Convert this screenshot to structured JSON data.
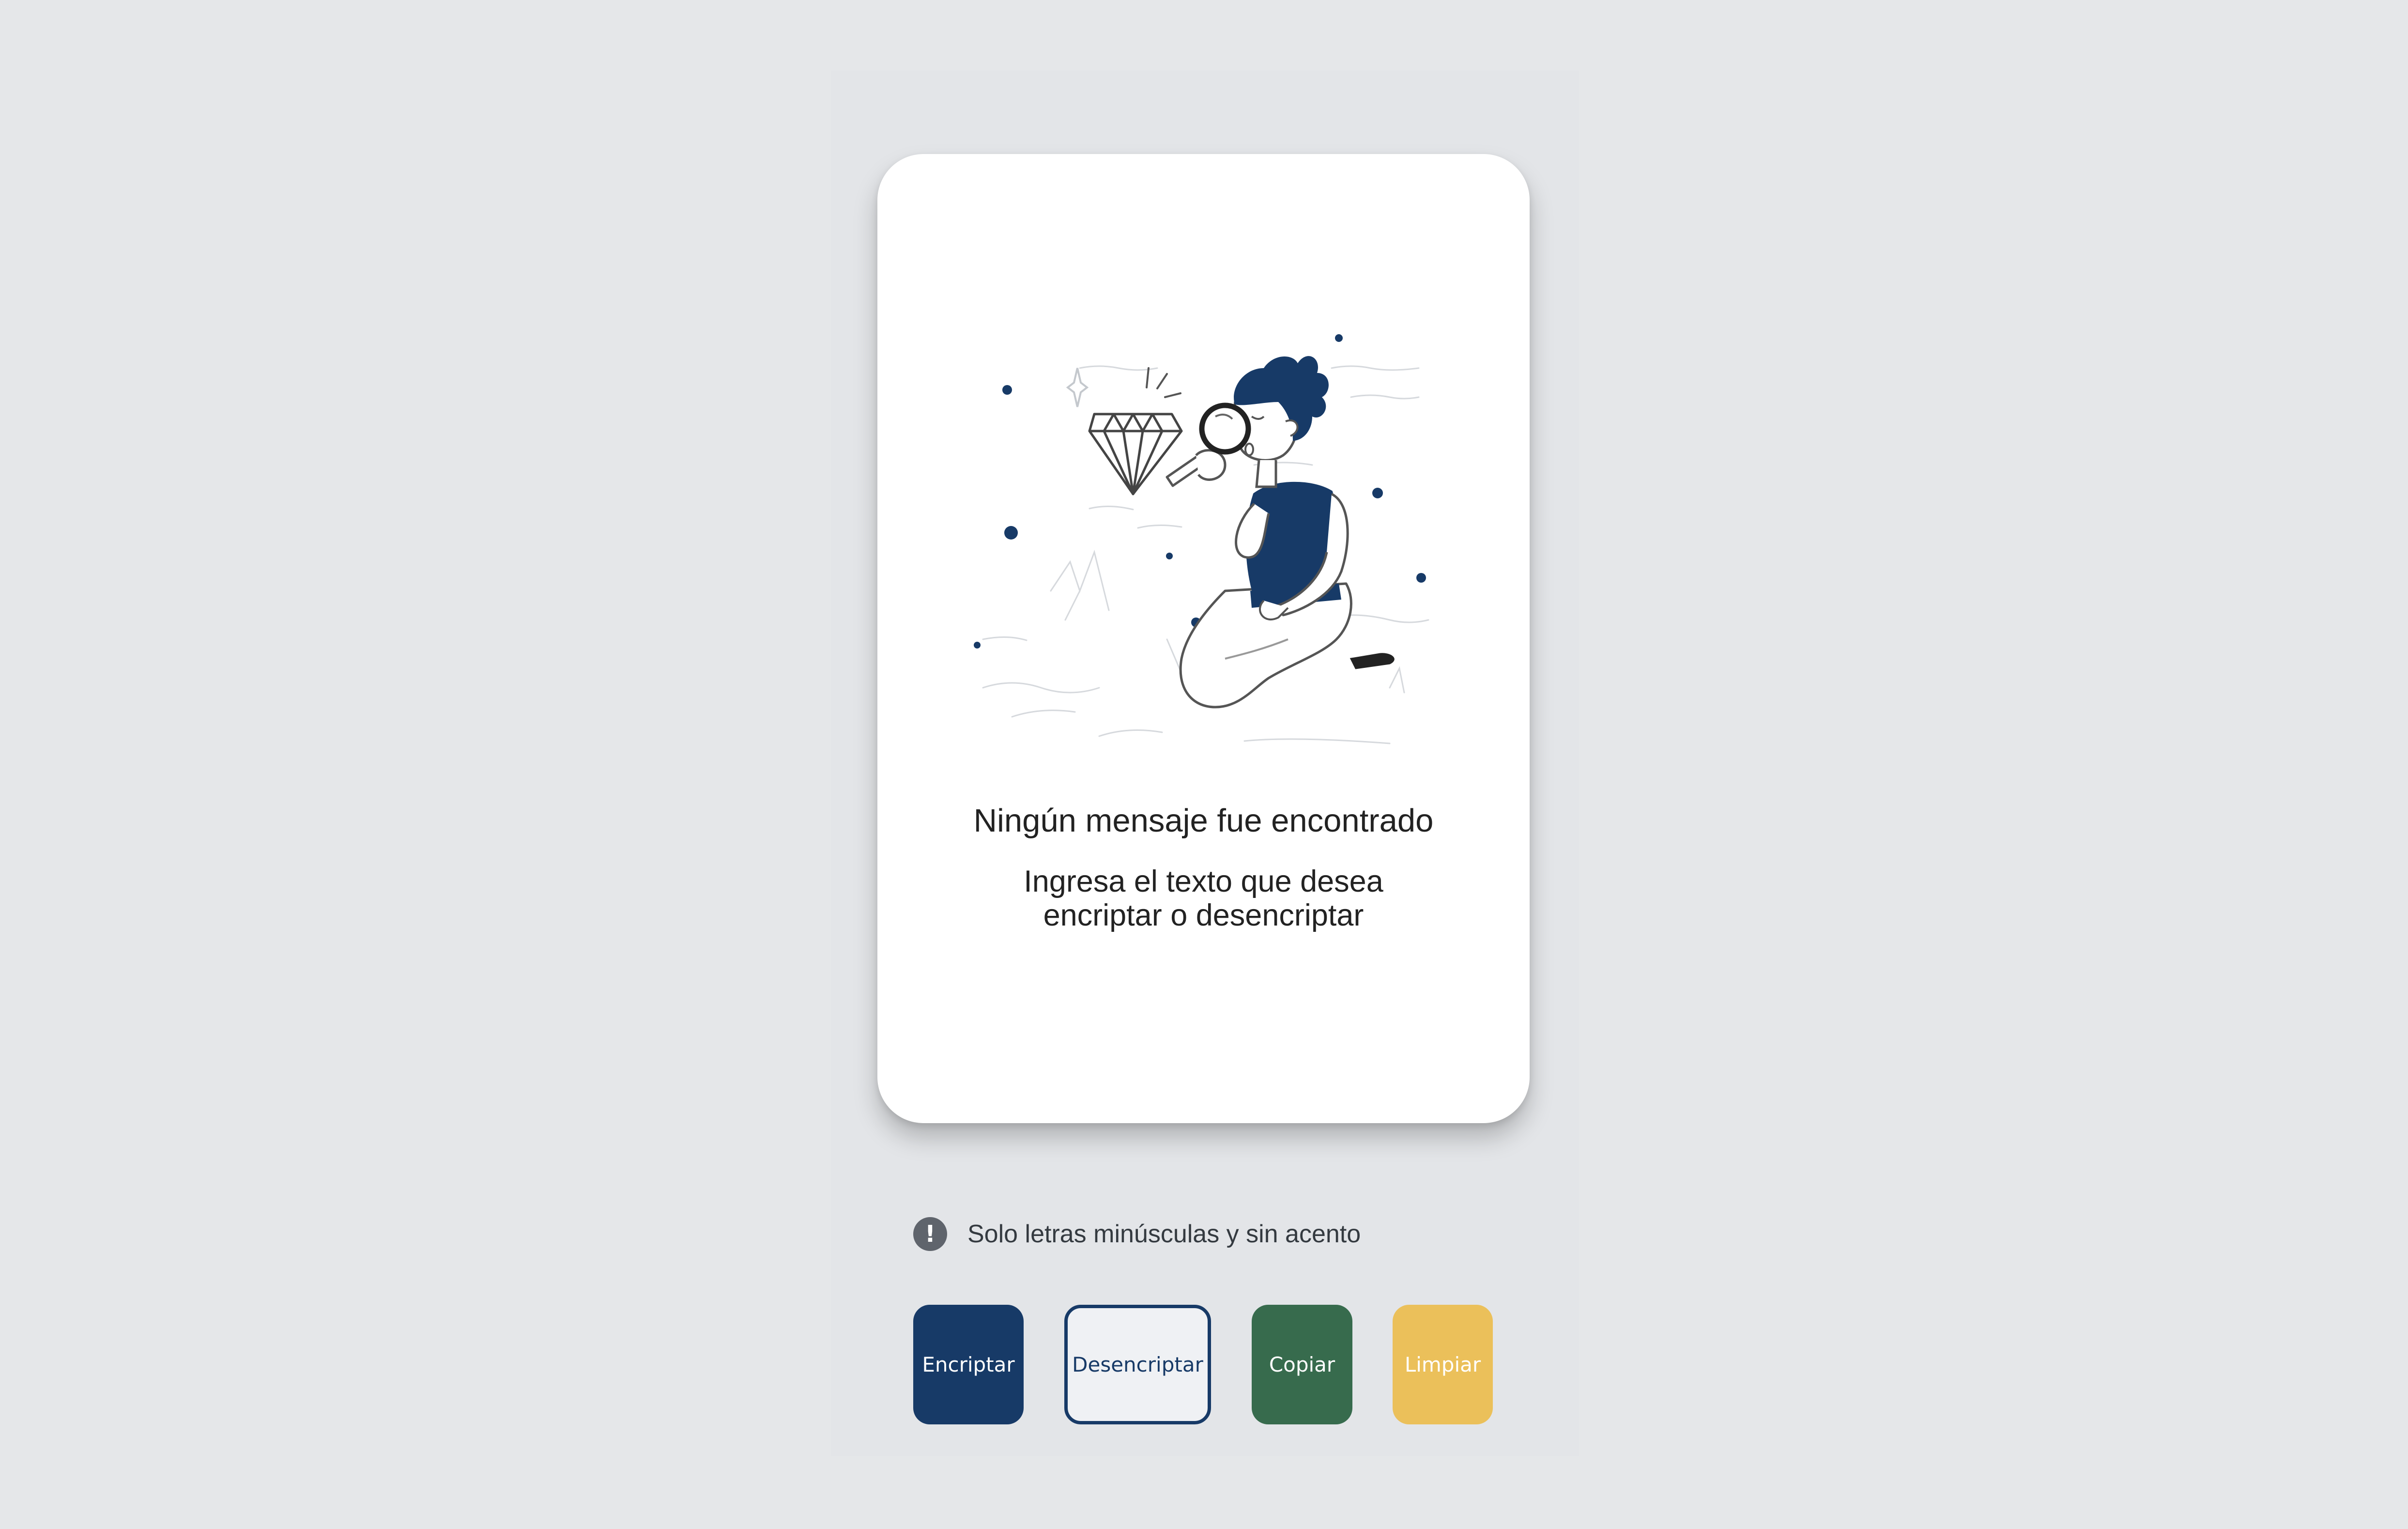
{
  "output": {
    "illustration": "person-with-magnifying-glass-examining-diamond",
    "title": "Ningún mensaje fue encontrado",
    "subtitle": "Ingresa el texto que desea encriptar o desencriptar"
  },
  "hint": {
    "icon": "exclamation-circle-icon",
    "icon_glyph": "!",
    "text": "Solo letras minúsculas y sin acento"
  },
  "buttons": {
    "encrypt_label": "Encriptar",
    "decrypt_label": "Desencriptar",
    "copy_label": "Copiar",
    "clear_label": "Limpiar"
  },
  "colors": {
    "background": "#e5e7e9",
    "card": "#ffffff",
    "primary_navy": "#173a67",
    "copy_green": "#376b4d",
    "clear_yellow": "#ebc05a",
    "hint_gray": "#5f646c"
  }
}
